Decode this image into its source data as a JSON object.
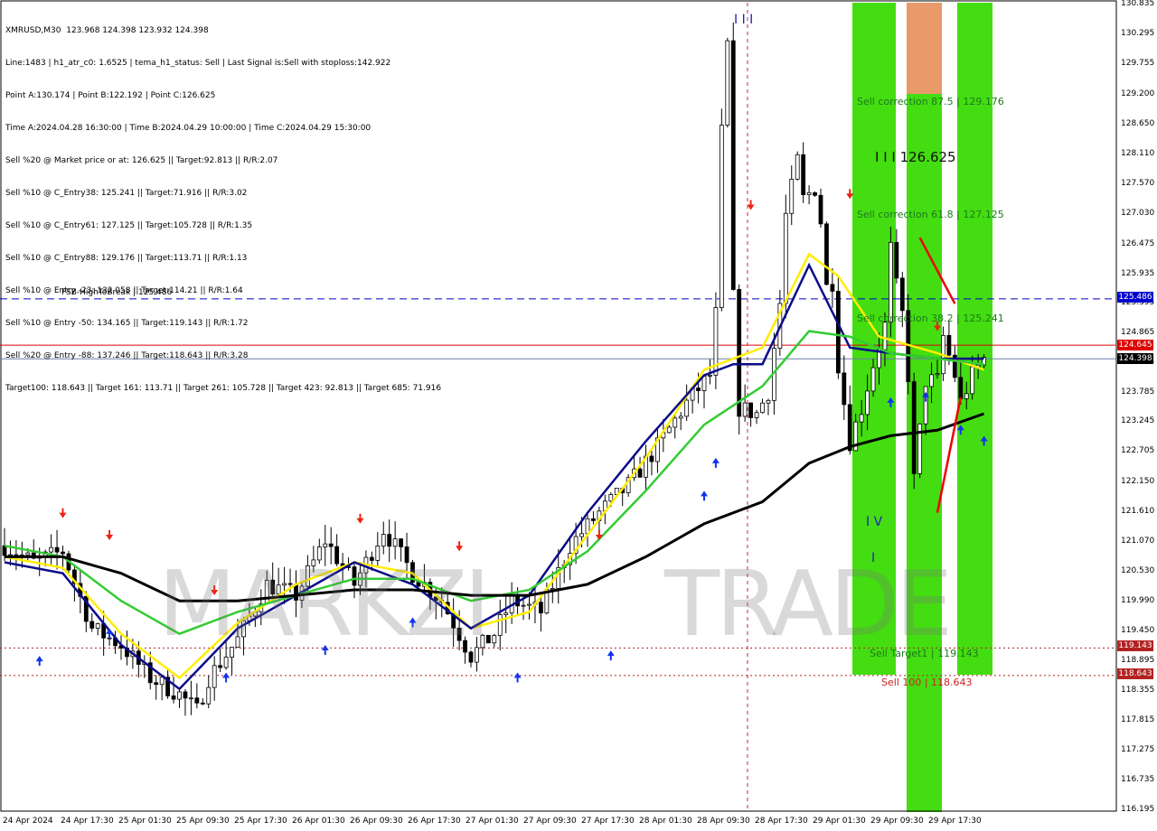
{
  "header": {
    "lines": [
      "XMRUSD,M30  123.968 124.398 123.932 124.398",
      "Line:1483 | h1_atr_c0: 1.6525 | tema_h1_status: Sell | Last Signal is:Sell with stoploss:142.922",
      "Point A:130.174 | Point B:122.192 | Point C:126.625",
      "Time A:2024.04.28 16:30:00 | Time B:2024.04.29 10:00:00 | Time C:2024.04.29 15:30:00",
      "Sell %20 @ Market price or at: 126.625 || Target:92.813 || R/R:2.07",
      "Sell %10 @ C_Entry38: 125.241 || Target:71.916 || R/R:3.02",
      "Sell %10 @ C_Entry61: 127.125 || Target:105.728 || R/R:1.35",
      "Sell %10 @ C_Entry88: 129.176 || Target:113.71 || R/R:1.13",
      "Sell %10 @ Entry -23: 132.058 || Target:114.21 || R/R:1.64",
      "Sell %10 @ Entry -50: 134.165 || Target:119.143 || R/R:1.72",
      "Sell %20 @ Entry -88: 137.246 || Target:118.643 || R/R:3.28",
      "Target100: 118.643 || Target 161: 113.71 || Target 261: 105.728 || Target 423: 92.813 || Target 685: 71.916"
    ]
  },
  "levels": {
    "fsb_label": "FSB-HighToBreak | 125.486",
    "fsb_tag": "125.486",
    "red_tag": "124.645",
    "price_tag": "124.398",
    "sell_target1_tag": "119.143",
    "sell_100_tag": "118.643",
    "colors": {
      "fsb": "#0000cc",
      "red": "#dd0000",
      "price": "#000000",
      "dotted": "#b22222"
    }
  },
  "zones": {
    "sell_correction_875": "Sell correction 87.5 | 129.176",
    "point_c": "I I I 126.625",
    "sell_correction_618": "Sell correction 61.8 | 127.125",
    "sell_correction_382": "Sell correction 38.2 | 125.241",
    "sell_target1": "Sell Target1 | 119.143",
    "sell_100": "Sell 100 | 118.643",
    "mark_top": "I I I",
    "mark_iv": "I V",
    "mark_i": "I"
  },
  "watermark": {
    "text_a": "MARKZI",
    "text_b": "TRADE"
  },
  "chart_data": {
    "type": "candlestick",
    "symbol": "XMRUSD",
    "timeframe": "M30",
    "y_range": [
      116.195,
      130.835
    ],
    "y_ticks": [
      "130.835",
      "130.295",
      "129.755",
      "129.200",
      "128.650",
      "128.110",
      "127.570",
      "127.030",
      "126.475",
      "125.935",
      "125.395",
      "124.865",
      "124.315",
      "123.785",
      "123.245",
      "122.705",
      "122.150",
      "121.610",
      "121.070",
      "120.530",
      "119.990",
      "119.450",
      "118.895",
      "118.355",
      "117.815",
      "117.275",
      "116.735",
      "116.195"
    ],
    "x_ticks": [
      "24 Apr 2024",
      "24 Apr 17:30",
      "25 Apr 01:30",
      "25 Apr 09:30",
      "25 Apr 17:30",
      "26 Apr 01:30",
      "26 Apr 09:30",
      "26 Apr 17:30",
      "27 Apr 01:30",
      "27 Apr 09:30",
      "27 Apr 17:30",
      "28 Apr 01:30",
      "28 Apr 09:30",
      "28 Apr 17:30",
      "29 Apr 01:30",
      "29 Apr 09:30",
      "29 Apr 17:30"
    ],
    "close_path": [
      [
        0,
        121.0
      ],
      [
        5,
        120.7
      ],
      [
        10,
        120.9
      ],
      [
        15,
        119.5
      ],
      [
        20,
        119.2
      ],
      [
        25,
        118.6
      ],
      [
        30,
        118.3
      ],
      [
        33,
        118.0
      ],
      [
        35,
        118.6
      ],
      [
        40,
        119.3
      ],
      [
        45,
        120.3
      ],
      [
        50,
        120.1
      ],
      [
        55,
        121.1
      ],
      [
        60,
        120.3
      ],
      [
        65,
        121.3
      ],
      [
        70,
        120.5
      ],
      [
        75,
        120.0
      ],
      [
        80,
        119.0
      ],
      [
        84,
        119.4
      ],
      [
        87,
        120.0
      ],
      [
        92,
        119.8
      ],
      [
        97,
        121.0
      ],
      [
        102,
        121.6
      ],
      [
        107,
        122.1
      ],
      [
        112,
        122.8
      ],
      [
        117,
        123.6
      ],
      [
        121,
        124.1
      ],
      [
        122,
        125.2
      ],
      [
        123,
        128.5
      ],
      [
        124,
        130.1
      ],
      [
        125,
        125.5
      ],
      [
        126,
        123.5
      ],
      [
        129,
        123.4
      ],
      [
        131,
        123.8
      ],
      [
        133,
        125.4
      ],
      [
        134,
        127.0
      ],
      [
        136,
        128.0
      ],
      [
        137,
        127.3
      ],
      [
        139,
        127.5
      ],
      [
        140,
        126.9
      ],
      [
        141,
        125.7
      ],
      [
        142,
        125.8
      ],
      [
        143,
        124.3
      ],
      [
        145,
        122.9
      ],
      [
        147,
        123.5
      ],
      [
        149,
        124.3
      ],
      [
        151,
        125.0
      ],
      [
        152,
        126.4
      ],
      [
        153,
        125.7
      ],
      [
        154,
        125.2
      ],
      [
        155,
        124.1
      ],
      [
        156,
        122.2
      ],
      [
        157,
        123.1
      ],
      [
        158,
        124.0
      ],
      [
        160,
        124.0
      ],
      [
        161,
        124.8
      ],
      [
        163,
        124.1
      ],
      [
        164,
        123.6
      ],
      [
        166,
        124.1
      ],
      [
        168,
        124.4
      ]
    ],
    "series": [
      {
        "name": "",
        "color": "#ffee00",
        "values": [
          [
            0,
            120.8
          ],
          [
            10,
            120.6
          ],
          [
            20,
            119.4
          ],
          [
            30,
            118.6
          ],
          [
            40,
            119.6
          ],
          [
            50,
            120.3
          ],
          [
            60,
            120.7
          ],
          [
            70,
            120.5
          ],
          [
            80,
            119.5
          ],
          [
            90,
            119.8
          ],
          [
            100,
            121.2
          ],
          [
            110,
            122.6
          ],
          [
            120,
            124.2
          ],
          [
            130,
            124.6
          ],
          [
            138,
            126.3
          ],
          [
            143,
            125.9
          ],
          [
            150,
            124.8
          ],
          [
            160,
            124.5
          ],
          [
            168,
            124.2
          ]
        ]
      },
      {
        "name": "",
        "color": "#0b0b8a",
        "values": [
          [
            0,
            120.7
          ],
          [
            10,
            120.5
          ],
          [
            20,
            119.2
          ],
          [
            30,
            118.4
          ],
          [
            40,
            119.5
          ],
          [
            50,
            120.1
          ],
          [
            60,
            120.7
          ],
          [
            70,
            120.3
          ],
          [
            80,
            119.5
          ],
          [
            90,
            120.1
          ],
          [
            100,
            121.6
          ],
          [
            110,
            122.9
          ],
          [
            120,
            124.1
          ],
          [
            125,
            124.3
          ],
          [
            130,
            124.3
          ],
          [
            138,
            126.1
          ],
          [
            145,
            124.6
          ],
          [
            152,
            124.5
          ],
          [
            160,
            124.4
          ],
          [
            168,
            124.4
          ]
        ]
      },
      {
        "name": "",
        "color": "#33cc33",
        "values": [
          [
            0,
            121.0
          ],
          [
            10,
            120.8
          ],
          [
            20,
            120.0
          ],
          [
            30,
            119.4
          ],
          [
            40,
            119.8
          ],
          [
            50,
            120.1
          ],
          [
            60,
            120.4
          ],
          [
            70,
            120.4
          ],
          [
            80,
            120.0
          ],
          [
            90,
            120.2
          ],
          [
            100,
            120.9
          ],
          [
            110,
            122.0
          ],
          [
            120,
            123.2
          ],
          [
            130,
            123.9
          ],
          [
            138,
            124.9
          ],
          [
            145,
            124.8
          ],
          [
            152,
            124.5
          ],
          [
            160,
            124.4
          ],
          [
            168,
            124.3
          ]
        ]
      },
      {
        "name": "",
        "color": "#000000",
        "values": [
          [
            0,
            120.8
          ],
          [
            10,
            120.8
          ],
          [
            20,
            120.5
          ],
          [
            30,
            120.0
          ],
          [
            40,
            120.0
          ],
          [
            50,
            120.1
          ],
          [
            60,
            120.2
          ],
          [
            70,
            120.2
          ],
          [
            80,
            120.1
          ],
          [
            90,
            120.1
          ],
          [
            100,
            120.3
          ],
          [
            110,
            120.8
          ],
          [
            120,
            121.4
          ],
          [
            130,
            121.8
          ],
          [
            138,
            122.5
          ],
          [
            145,
            122.8
          ],
          [
            152,
            123.0
          ],
          [
            160,
            123.1
          ],
          [
            168,
            123.4
          ]
        ]
      }
    ]
  }
}
